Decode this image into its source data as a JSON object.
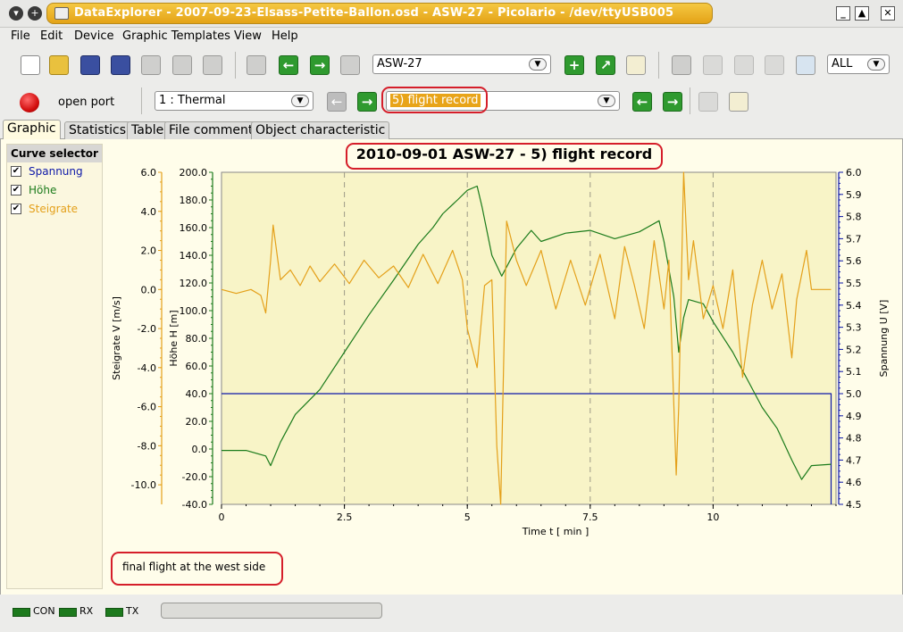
{
  "window": {
    "title": "DataExplorer  -  2007-09-23-Elsass-Petite-Ballon.osd  -  ASW-27  -  Picolario  -  /dev/ttyUSB005"
  },
  "menu": [
    "File",
    "Edit",
    "Device",
    "Graphic Templates",
    "View",
    "Help"
  ],
  "toolbar": {
    "device_combo": "ASW-27",
    "scope_combo": "ALL"
  },
  "toolbar2": {
    "port_label": "open port",
    "channel_combo": "1 : Thermal",
    "record_combo": "5) flight record"
  },
  "tabs": [
    "Graphic",
    "Statistics",
    "Table",
    "File comment",
    "Object characteristic"
  ],
  "curve_selector": {
    "title": "Curve selector",
    "items": [
      {
        "label": "Spannung",
        "checked": true,
        "color": "#0d18a8"
      },
      {
        "label": "Höhe",
        "checked": true,
        "color": "#1b7b1b"
      },
      {
        "label": "Steigrate",
        "checked": true,
        "color": "#e4a01a"
      }
    ]
  },
  "comment": "final flight at the west side",
  "status": {
    "indicators": [
      "CON",
      "RX",
      "TX"
    ]
  },
  "chart_data": {
    "type": "line",
    "title": "2010-09-01 ASW-27 - 5) flight record",
    "xlabel": "Time   t   [ min ]",
    "xlim": [
      0,
      12.5
    ],
    "x_ticks": [
      0,
      2.5,
      5,
      7.5,
      10
    ],
    "x_tick_labels": [
      "0",
      "2.5",
      "5",
      "7.5",
      "10"
    ],
    "axes": [
      {
        "label": "Steigrate   V   [m/s]",
        "side": "left-outer",
        "min": -11.0,
        "max": 6.0,
        "ticks": [
          "6.0",
          "4.0",
          "2.0",
          "0.0",
          "-2.0",
          "-4.0",
          "-6.0",
          "-8.0",
          "-10.0"
        ],
        "tick_values": [
          6,
          4,
          2,
          0,
          -2,
          -4,
          -6,
          -8,
          -10
        ],
        "color": "#e4a01a"
      },
      {
        "label": "Höhe   H   [m]",
        "side": "left-inner",
        "min": -40.0,
        "max": 200.0,
        "ticks": [
          "200.0",
          "180.0",
          "160.0",
          "140.0",
          "120.0",
          "100.0",
          "80.0",
          "60.0",
          "40.0",
          "20.0",
          "0.0",
          "-20.0",
          "-40.0"
        ],
        "tick_values": [
          200,
          180,
          160,
          140,
          120,
          100,
          80,
          60,
          40,
          20,
          0,
          -20,
          -40
        ],
        "color": "#1b7b1b"
      },
      {
        "label": "Spannung   U   [V]",
        "side": "right",
        "min": 4.5,
        "max": 6.0,
        "ticks": [
          "6.0",
          "5.9",
          "5.8",
          "5.7",
          "5.6",
          "5.5",
          "5.4",
          "5.3",
          "5.2",
          "5.1",
          "5.0",
          "4.9",
          "4.8",
          "4.7",
          "4.6",
          "4.5"
        ],
        "tick_values": [
          6.0,
          5.9,
          5.8,
          5.7,
          5.6,
          5.5,
          5.4,
          5.3,
          5.2,
          5.1,
          5.0,
          4.9,
          4.8,
          4.7,
          4.6,
          4.5
        ],
        "color": "#0d18a8"
      }
    ],
    "grid": "dashed vertical",
    "series": [
      {
        "name": "Spannung",
        "axis": 2,
        "color": "#0d18a8",
        "x": [
          0,
          12.4,
          12.4
        ],
        "y": [
          5.0,
          5.0,
          4.5
        ]
      },
      {
        "name": "Höhe",
        "axis": 1,
        "color": "#1b7b1b",
        "x": [
          0,
          0.5,
          0.9,
          1.0,
          1.2,
          1.5,
          2.0,
          2.5,
          3.0,
          3.5,
          4.0,
          4.3,
          4.5,
          4.8,
          5.0,
          5.2,
          5.3,
          5.5,
          5.7,
          6.0,
          6.3,
          6.5,
          7.0,
          7.5,
          8.0,
          8.5,
          8.9,
          9.0,
          9.2,
          9.3,
          9.4,
          9.5,
          9.8,
          10.0,
          10.4,
          10.7,
          11.0,
          11.3,
          11.6,
          11.8,
          12.0,
          12.4
        ],
        "y": [
          -1,
          -1,
          -5,
          -12,
          5,
          25,
          43,
          70,
          97,
          122,
          148,
          160,
          170,
          180,
          187,
          190,
          175,
          140,
          125,
          145,
          158,
          150,
          156,
          158,
          152,
          157,
          165,
          150,
          110,
          70,
          95,
          108,
          105,
          92,
          70,
          50,
          30,
          15,
          -8,
          -22,
          -12,
          -11
        ]
      },
      {
        "name": "Steigrate",
        "axis": 0,
        "color": "#e4a01a",
        "x": [
          0,
          0.3,
          0.6,
          0.8,
          0.9,
          1.0,
          1.05,
          1.2,
          1.4,
          1.6,
          1.8,
          2.0,
          2.3,
          2.6,
          2.9,
          3.2,
          3.5,
          3.8,
          4.1,
          4.4,
          4.7,
          4.9,
          5.0,
          5.2,
          5.35,
          5.5,
          5.6,
          5.68,
          5.8,
          6.0,
          6.2,
          6.5,
          6.8,
          7.1,
          7.4,
          7.7,
          8.0,
          8.2,
          8.4,
          8.6,
          8.8,
          9.0,
          9.1,
          9.25,
          9.3,
          9.4,
          9.5,
          9.6,
          9.8,
          10.0,
          10.2,
          10.4,
          10.6,
          10.8,
          11.0,
          11.2,
          11.4,
          11.6,
          11.7,
          11.9,
          12.0,
          12.4
        ],
        "y": [
          0.0,
          -0.2,
          0.0,
          -0.3,
          -1.2,
          1.5,
          3.3,
          0.5,
          1.0,
          0.2,
          1.2,
          0.4,
          1.3,
          0.3,
          1.5,
          0.6,
          1.2,
          0.1,
          1.8,
          0.3,
          2.0,
          0.5,
          -2.0,
          -4.0,
          0.2,
          0.5,
          -8.0,
          -11.0,
          3.5,
          1.5,
          0.2,
          2.0,
          -1.0,
          1.5,
          -0.8,
          1.8,
          -1.5,
          2.2,
          0.2,
          -2.0,
          2.5,
          -1.0,
          1.5,
          -9.5,
          -6.0,
          6.0,
          0.5,
          2.5,
          -1.5,
          0.2,
          -2.0,
          1.0,
          -4.5,
          -0.8,
          1.5,
          -1.0,
          0.8,
          -3.5,
          -0.5,
          2.0,
          0.0,
          0.0
        ]
      }
    ]
  }
}
